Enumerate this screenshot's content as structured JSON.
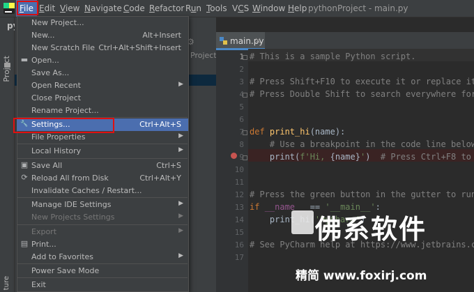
{
  "menubar": {
    "items": [
      {
        "text": "File",
        "underline_index": 0
      },
      {
        "text": "Edit",
        "underline_index": 0
      },
      {
        "text": "View",
        "underline_index": 0
      },
      {
        "text": "Navigate",
        "underline_index": 0
      },
      {
        "text": "Code",
        "underline_index": 0
      },
      {
        "text": "Refactor",
        "underline_index": 0
      },
      {
        "text": "Run",
        "underline_index": 1
      },
      {
        "text": "Tools",
        "underline_index": 0
      },
      {
        "text": "VCS",
        "underline_index": 1
      },
      {
        "text": "Window",
        "underline_index": 0
      },
      {
        "text": "Help",
        "underline_index": 0
      }
    ],
    "title": "pythonProject - main.py"
  },
  "left_strip": {
    "project_label": "Project",
    "structure_label": "ture",
    "py_stub": "pyt"
  },
  "project_panel": {
    "ghost_text": "Project"
  },
  "editor": {
    "tab_label": "main.py",
    "line_numbers": [
      "1",
      "2",
      "3",
      "4",
      "5",
      "6",
      "7",
      "8",
      "9",
      "10",
      "11",
      "12",
      "13",
      "14",
      "15",
      "16",
      "17"
    ],
    "lines": [
      {
        "n": 1,
        "segments": [
          {
            "t": "# This is a sample Python script.",
            "c": "cm"
          }
        ]
      },
      {
        "n": 2,
        "segments": []
      },
      {
        "n": 3,
        "segments": [
          {
            "t": "# Press Shift+F10 to execute it or replace it w",
            "c": "cm"
          }
        ]
      },
      {
        "n": 4,
        "segments": [
          {
            "t": "# Press Double Shift to search everywhere for c",
            "c": "cm"
          }
        ]
      },
      {
        "n": 5,
        "segments": []
      },
      {
        "n": 6,
        "segments": []
      },
      {
        "n": 7,
        "segments": [
          {
            "t": "def ",
            "c": "kw"
          },
          {
            "t": "print_hi",
            "c": "fn"
          },
          {
            "t": "(name):",
            "c": ""
          }
        ]
      },
      {
        "n": 8,
        "segments": [
          {
            "t": "    # Use a breakpoint in the code line below t",
            "c": "cm"
          }
        ]
      },
      {
        "n": 9,
        "segments": [
          {
            "t": "    print(",
            "c": ""
          },
          {
            "t": "f'Hi, ",
            "c": "st"
          },
          {
            "t": "{name}",
            "c": ""
          },
          {
            "t": "'",
            "c": "st"
          },
          {
            "t": ")  ",
            "c": ""
          },
          {
            "t": "# Press Ctrl+F8 to to",
            "c": "cm"
          }
        ]
      },
      {
        "n": 10,
        "segments": []
      },
      {
        "n": 11,
        "segments": []
      },
      {
        "n": 12,
        "segments": [
          {
            "t": "# Press the green button in the gutter to run t",
            "c": "cm"
          }
        ]
      },
      {
        "n": 13,
        "segments": [
          {
            "t": "if ",
            "c": "kw"
          },
          {
            "t": "__name__",
            "c": "var"
          },
          {
            "t": " == ",
            "c": ""
          },
          {
            "t": "'__main__'",
            "c": "st"
          },
          {
            "t": ":",
            "c": ""
          }
        ]
      },
      {
        "n": 14,
        "segments": [
          {
            "t": "    print_hi(",
            "c": ""
          },
          {
            "t": "'PyCharm'",
            "c": "st"
          },
          {
            "t": ")",
            "c": ""
          }
        ]
      },
      {
        "n": 15,
        "segments": []
      },
      {
        "n": 16,
        "segments": [
          {
            "t": "# See PyCharm help at https://www.jetbrains.com",
            "c": "cm"
          }
        ]
      },
      {
        "n": 17,
        "segments": []
      }
    ]
  },
  "file_menu": {
    "items": [
      {
        "id": "new-project",
        "label": "New Project...",
        "shortcut": "",
        "arrow": false,
        "icon": "",
        "disabled": false,
        "highlight": false
      },
      {
        "id": "new",
        "label": "New...",
        "shortcut": "Alt+Insert",
        "arrow": false,
        "icon": "",
        "disabled": false,
        "highlight": false
      },
      {
        "id": "new-scratch-file",
        "label": "New Scratch File",
        "shortcut": "Ctrl+Alt+Shift+Insert",
        "arrow": false,
        "icon": "",
        "disabled": false,
        "highlight": false
      },
      {
        "id": "open",
        "label": "Open...",
        "shortcut": "",
        "arrow": false,
        "icon": "folder-icon",
        "disabled": false,
        "highlight": false
      },
      {
        "id": "save-as",
        "label": "Save As...",
        "shortcut": "",
        "arrow": false,
        "icon": "",
        "disabled": false,
        "highlight": false
      },
      {
        "id": "open-recent",
        "label": "Open Recent",
        "shortcut": "",
        "arrow": true,
        "icon": "",
        "disabled": false,
        "highlight": false
      },
      {
        "id": "close-project",
        "label": "Close Project",
        "shortcut": "",
        "arrow": false,
        "icon": "",
        "disabled": false,
        "highlight": false
      },
      {
        "id": "rename-project",
        "label": "Rename Project...",
        "shortcut": "",
        "arrow": false,
        "icon": "",
        "disabled": false,
        "highlight": false
      },
      {
        "id": "settings",
        "label": "Settings...",
        "shortcut": "Ctrl+Alt+S",
        "arrow": false,
        "icon": "wrench-icon",
        "disabled": false,
        "highlight": true
      },
      {
        "id": "file-properties",
        "label": "File Properties",
        "shortcut": "",
        "arrow": true,
        "icon": "",
        "disabled": false,
        "highlight": false
      },
      {
        "id": "local-history",
        "label": "Local History",
        "shortcut": "",
        "arrow": true,
        "icon": "",
        "disabled": false,
        "highlight": false
      },
      {
        "id": "save-all",
        "label": "Save All",
        "shortcut": "Ctrl+S",
        "arrow": false,
        "icon": "save-icon",
        "disabled": false,
        "highlight": false
      },
      {
        "id": "reload-all",
        "label": "Reload All from Disk",
        "shortcut": "Ctrl+Alt+Y",
        "arrow": false,
        "icon": "reload-icon",
        "disabled": false,
        "highlight": false
      },
      {
        "id": "invalidate-caches",
        "label": "Invalidate Caches / Restart...",
        "shortcut": "",
        "arrow": false,
        "icon": "",
        "disabled": false,
        "highlight": false
      },
      {
        "id": "manage-ide-settings",
        "label": "Manage IDE Settings",
        "shortcut": "",
        "arrow": true,
        "icon": "",
        "disabled": false,
        "highlight": false
      },
      {
        "id": "new-projects-settings",
        "label": "New Projects Settings",
        "shortcut": "",
        "arrow": true,
        "icon": "",
        "disabled": true,
        "highlight": false
      },
      {
        "id": "export",
        "label": "Export",
        "shortcut": "",
        "arrow": true,
        "icon": "",
        "disabled": true,
        "highlight": false
      },
      {
        "id": "print",
        "label": "Print...",
        "shortcut": "",
        "arrow": false,
        "icon": "print-icon",
        "disabled": false,
        "highlight": false
      },
      {
        "id": "add-to-favorites",
        "label": "Add to Favorites",
        "shortcut": "",
        "arrow": true,
        "icon": "",
        "disabled": false,
        "highlight": false
      },
      {
        "id": "power-save-mode",
        "label": "Power Save Mode",
        "shortcut": "",
        "arrow": false,
        "icon": "",
        "disabled": false,
        "highlight": false
      },
      {
        "id": "exit",
        "label": "Exit",
        "shortcut": "",
        "arrow": false,
        "icon": "",
        "disabled": false,
        "highlight": false
      }
    ]
  },
  "watermark": {
    "logo_text": "佛系软件",
    "site_text": "精简 www.foxirj.com"
  },
  "colors": {
    "accent": "#4b6eaf",
    "annotation_red": "#e01010",
    "background": "#2b2b2b",
    "panel": "#3c3f41"
  }
}
